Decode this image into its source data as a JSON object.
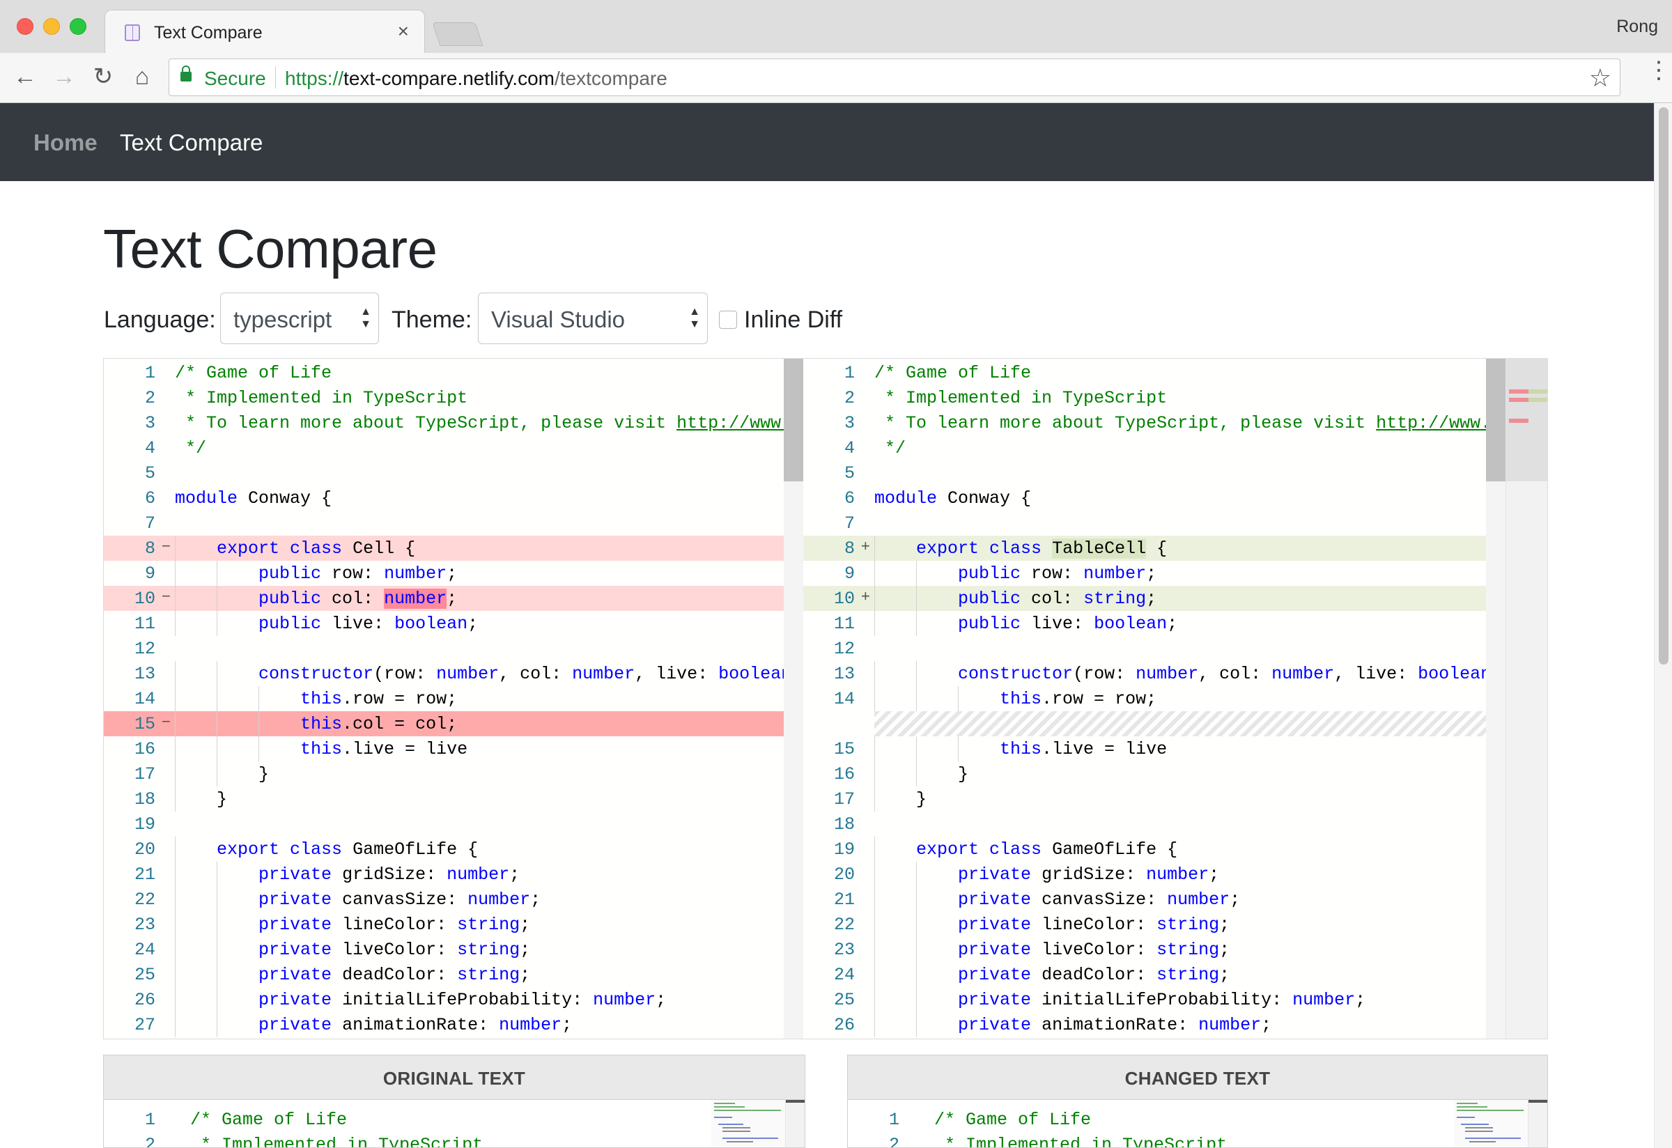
{
  "browser": {
    "tab_title": "Text Compare",
    "tab_close": "×",
    "profile_name": "Rong",
    "nav": {
      "back": "←",
      "forward": "→",
      "reload": "↻",
      "home": "⌂"
    },
    "secure_label": "Secure",
    "url": {
      "scheme": "https://",
      "host": "text-compare.netlify.com",
      "path": "/textcompare"
    },
    "bookmark_icon": "☆",
    "menu_icon": "⋮"
  },
  "navbar": {
    "home": "Home",
    "brand": "Text Compare"
  },
  "page": {
    "title": "Text Compare",
    "language_label": "Language:",
    "language_value": "typescript",
    "theme_label": "Theme:",
    "theme_value": "Visual Studio",
    "select_arrows": "▲\n▼",
    "inline_diff_label": "Inline Diff",
    "inline_diff_checked": false
  },
  "colors": {
    "navbar_bg": "#343a40",
    "deleted_line": "#ffd7d7",
    "deleted_strong": "#ffaaaa",
    "inserted_line": "#ebf1dd",
    "keyword": "#0000ff",
    "comment": "#008000",
    "line_number": "#237893"
  },
  "diff": {
    "original": [
      {
        "n": "1",
        "code": "/* Game of Life",
        "type": ""
      },
      {
        "n": "2",
        "code": " * Implemented in TypeScript",
        "type": ""
      },
      {
        "n": "3",
        "code": " * To learn more about TypeScript, please visit http://www.type",
        "type": ""
      },
      {
        "n": "4",
        "code": " */",
        "type": ""
      },
      {
        "n": "5",
        "code": "",
        "type": ""
      },
      {
        "n": "6",
        "code": "module Conway {",
        "type": ""
      },
      {
        "n": "7",
        "code": "",
        "type": ""
      },
      {
        "n": "8",
        "code": "    export class Cell {",
        "type": "del",
        "sign": "−"
      },
      {
        "n": "9",
        "code": "        public row: number;",
        "type": ""
      },
      {
        "n": "10",
        "code": "        public col: number;",
        "type": "del",
        "sign": "−",
        "hl": "number"
      },
      {
        "n": "11",
        "code": "        public live: boolean;",
        "type": ""
      },
      {
        "n": "12",
        "code": "",
        "type": ""
      },
      {
        "n": "13",
        "code": "        constructor(row: number, col: number, live: boolean) {",
        "type": ""
      },
      {
        "n": "14",
        "code": "            this.row = row;",
        "type": ""
      },
      {
        "n": "15",
        "code": "            this.col = col;",
        "type": "del-strong",
        "sign": "−"
      },
      {
        "n": "16",
        "code": "            this.live = live",
        "type": ""
      },
      {
        "n": "17",
        "code": "        }",
        "type": ""
      },
      {
        "n": "18",
        "code": "    }",
        "type": ""
      },
      {
        "n": "19",
        "code": "",
        "type": ""
      },
      {
        "n": "20",
        "code": "    export class GameOfLife {",
        "type": ""
      },
      {
        "n": "21",
        "code": "        private gridSize: number;",
        "type": ""
      },
      {
        "n": "22",
        "code": "        private canvasSize: number;",
        "type": ""
      },
      {
        "n": "23",
        "code": "        private lineColor: string;",
        "type": ""
      },
      {
        "n": "24",
        "code": "        private liveColor: string;",
        "type": ""
      },
      {
        "n": "25",
        "code": "        private deadColor: string;",
        "type": ""
      },
      {
        "n": "26",
        "code": "        private initialLifeProbability: number;",
        "type": ""
      },
      {
        "n": "27",
        "code": "        private animationRate: number;",
        "type": ""
      }
    ],
    "modified": [
      {
        "n": "1",
        "code": "/* Game of Life",
        "type": ""
      },
      {
        "n": "2",
        "code": " * Implemented in TypeScript",
        "type": ""
      },
      {
        "n": "3",
        "code": " * To learn more about TypeScript, please visit http://www.type",
        "type": ""
      },
      {
        "n": "4",
        "code": " */",
        "type": ""
      },
      {
        "n": "5",
        "code": "",
        "type": ""
      },
      {
        "n": "6",
        "code": "module Conway {",
        "type": ""
      },
      {
        "n": "7",
        "code": "",
        "type": ""
      },
      {
        "n": "8",
        "code": "    export class TableCell {",
        "type": "ins",
        "sign": "+",
        "hl": "TableCell"
      },
      {
        "n": "9",
        "code": "        public row: number;",
        "type": ""
      },
      {
        "n": "10",
        "code": "        public col: string;",
        "type": "ins",
        "sign": "+"
      },
      {
        "n": "11",
        "code": "        public live: boolean;",
        "type": ""
      },
      {
        "n": "12",
        "code": "",
        "type": ""
      },
      {
        "n": "13",
        "code": "        constructor(row: number, col: number, live: boolean) {",
        "type": ""
      },
      {
        "n": "14",
        "code": "            this.row = row;",
        "type": ""
      },
      {
        "n": "",
        "code": "",
        "type": "hatch"
      },
      {
        "n": "15",
        "code": "            this.live = live",
        "type": ""
      },
      {
        "n": "16",
        "code": "        }",
        "type": ""
      },
      {
        "n": "17",
        "code": "    }",
        "type": ""
      },
      {
        "n": "18",
        "code": "",
        "type": ""
      },
      {
        "n": "19",
        "code": "    export class GameOfLife {",
        "type": ""
      },
      {
        "n": "20",
        "code": "        private gridSize: number;",
        "type": ""
      },
      {
        "n": "21",
        "code": "        private canvasSize: number;",
        "type": ""
      },
      {
        "n": "22",
        "code": "        private lineColor: string;",
        "type": ""
      },
      {
        "n": "23",
        "code": "        private liveColor: string;",
        "type": ""
      },
      {
        "n": "24",
        "code": "        private deadColor: string;",
        "type": ""
      },
      {
        "n": "25",
        "code": "        private initialLifeProbability: number;",
        "type": ""
      },
      {
        "n": "26",
        "code": "        private animationRate: number;",
        "type": ""
      }
    ]
  },
  "panels": {
    "original": {
      "title": "ORIGINAL TEXT",
      "lines": [
        {
          "n": "1",
          "code": "/* Game of Life"
        },
        {
          "n": "2",
          "code": " * Implemented in TypeScript"
        }
      ]
    },
    "changed": {
      "title": "CHANGED TEXT",
      "lines": [
        {
          "n": "1",
          "code": "/* Game of Life"
        },
        {
          "n": "2",
          "code": " * Implemented in TypeScript"
        }
      ]
    }
  }
}
